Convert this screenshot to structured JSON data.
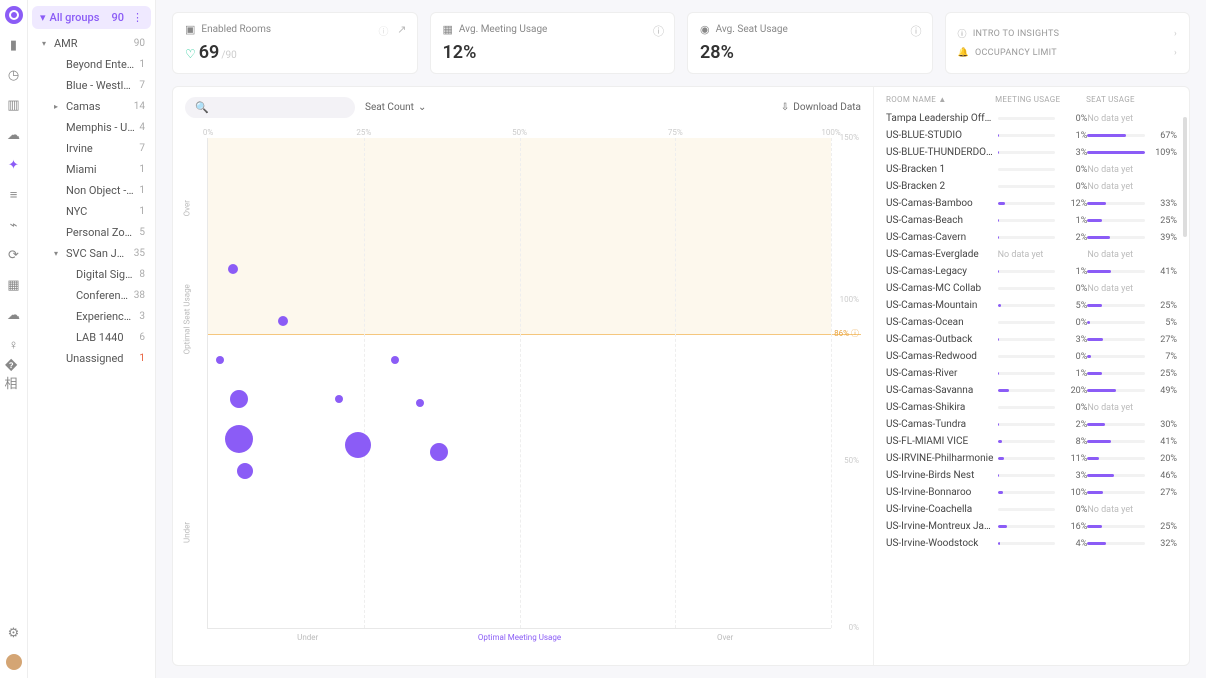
{
  "sidebar": {
    "allGroups": {
      "label": "All groups",
      "count": 90
    },
    "tree": [
      {
        "label": "AMR",
        "count": 90,
        "caret": "▾",
        "cls": ""
      },
      {
        "label": "Beyond Entertain...",
        "count": 1,
        "cls": "child"
      },
      {
        "label": "Blue - Westlake",
        "count": 7,
        "cls": "child"
      },
      {
        "label": "Camas",
        "count": 14,
        "caret": "▸",
        "cls": "child"
      },
      {
        "label": "Memphis - USDC",
        "count": 4,
        "cls": "child"
      },
      {
        "label": "Irvine",
        "count": 7,
        "cls": "child"
      },
      {
        "label": "Miami",
        "count": 1,
        "cls": "child"
      },
      {
        "label": "Non Object - Port...",
        "count": 1,
        "cls": "child"
      },
      {
        "label": "NYC",
        "count": 1,
        "cls": "child"
      },
      {
        "label": "Personal ZoomRo...",
        "count": 5,
        "cls": "child"
      },
      {
        "label": "SVC San Jose",
        "count": 35,
        "caret": "▾",
        "cls": "child"
      },
      {
        "label": "Digital Signage",
        "count": 8,
        "cls": "grandchild"
      },
      {
        "label": "Conference Roo...",
        "count": 38,
        "cls": "grandchild"
      },
      {
        "label": "Experience Center",
        "count": 3,
        "cls": "grandchild"
      },
      {
        "label": "LAB 1440",
        "count": 6,
        "cls": "grandchild"
      },
      {
        "label": "Unassigned",
        "count": 1,
        "cls": "child",
        "red": true
      }
    ]
  },
  "kpi": {
    "enabled": {
      "label": "Enabled Rooms",
      "value": "69",
      "sub": "/90"
    },
    "meeting": {
      "label": "Avg. Meeting Usage",
      "value": "12%"
    },
    "seat": {
      "label": "Avg. Seat Usage",
      "value": "28%"
    },
    "links": [
      {
        "icon": "ⓘ",
        "label": "INTRO TO INSIGHTS"
      },
      {
        "icon": "🔔",
        "label": "OCCUPANCY LIMIT"
      }
    ]
  },
  "toolbar": {
    "sort": "Seat Count",
    "download": "Download Data"
  },
  "chart_data": {
    "type": "scatter",
    "xlabel_segments": [
      "Under",
      "Optimal Meeting Usage",
      "Over"
    ],
    "ylabel_segments": [
      "Under",
      "Optimal Seat Usage",
      "Over"
    ],
    "x_ticks": [
      "0%",
      "25%",
      "50%",
      "75%",
      "100%"
    ],
    "y_right_ticks": [
      "150%",
      "100%",
      "50%",
      "0%"
    ],
    "band_label": "86% ⓘ",
    "bubbles": [
      {
        "x": 4,
        "y": 110,
        "r": 5
      },
      {
        "x": 12,
        "y": 94,
        "r": 5
      },
      {
        "x": 2,
        "y": 82,
        "r": 4
      },
      {
        "x": 30,
        "y": 82,
        "r": 4
      },
      {
        "x": 5,
        "y": 70,
        "r": 9
      },
      {
        "x": 21,
        "y": 70,
        "r": 4
      },
      {
        "x": 34,
        "y": 69,
        "r": 4
      },
      {
        "x": 5,
        "y": 58,
        "r": 14
      },
      {
        "x": 24,
        "y": 56,
        "r": 13
      },
      {
        "x": 37,
        "y": 54,
        "r": 9
      },
      {
        "x": 6,
        "y": 48,
        "r": 8
      }
    ]
  },
  "table": {
    "headers": [
      "ROOM NAME ▲",
      "MEETING USAGE",
      "SEAT USAGE"
    ],
    "rows": [
      {
        "name": "Tampa Leadership Offsite",
        "m": 0,
        "s": null
      },
      {
        "name": "US-BLUE-STUDIO",
        "m": 1,
        "s": 67
      },
      {
        "name": "US-BLUE-THUNDERDOME",
        "m": 3,
        "s": 109
      },
      {
        "name": "US-Bracken 1",
        "m": 0,
        "s": null
      },
      {
        "name": "US-Bracken 2",
        "m": 0,
        "s": null
      },
      {
        "name": "US-Camas-Bamboo",
        "m": 12,
        "s": 33
      },
      {
        "name": "US-Camas-Beach",
        "m": 1,
        "s": 25
      },
      {
        "name": "US-Camas-Cavern",
        "m": 2,
        "s": 39
      },
      {
        "name": "US-Camas-Everglade",
        "m": null,
        "s": null
      },
      {
        "name": "US-Camas-Legacy",
        "m": 1,
        "s": 41
      },
      {
        "name": "US-Camas-MC Collab",
        "m": 0,
        "s": null
      },
      {
        "name": "US-Camas-Mountain",
        "m": 5,
        "s": 25
      },
      {
        "name": "US-Camas-Ocean",
        "m": 0,
        "s": 5
      },
      {
        "name": "US-Camas-Outback",
        "m": 3,
        "s": 27
      },
      {
        "name": "US-Camas-Redwood",
        "m": 0,
        "s": 7
      },
      {
        "name": "US-Camas-River",
        "m": 1,
        "s": 25
      },
      {
        "name": "US-Camas-Savanna",
        "m": 20,
        "s": 49
      },
      {
        "name": "US-Camas-Shikira",
        "m": 0,
        "s": null
      },
      {
        "name": "US-Camas-Tundra",
        "m": 2,
        "s": 30
      },
      {
        "name": "US-FL-MIAMI VICE",
        "m": 8,
        "s": 41
      },
      {
        "name": "US-IRVINE-Philharmonie",
        "m": 11,
        "s": 20
      },
      {
        "name": "US-Irvine-Birds Nest",
        "m": 3,
        "s": 46
      },
      {
        "name": "US-Irvine-Bonnaroo",
        "m": 10,
        "s": 27
      },
      {
        "name": "US-Irvine-Coachella",
        "m": 0,
        "s": null
      },
      {
        "name": "US-Irvine-Montreux Jazz",
        "m": 16,
        "s": 25
      },
      {
        "name": "US-Irvine-Woodstock",
        "m": 4,
        "s": 32
      }
    ],
    "nodata": "No data yet"
  }
}
